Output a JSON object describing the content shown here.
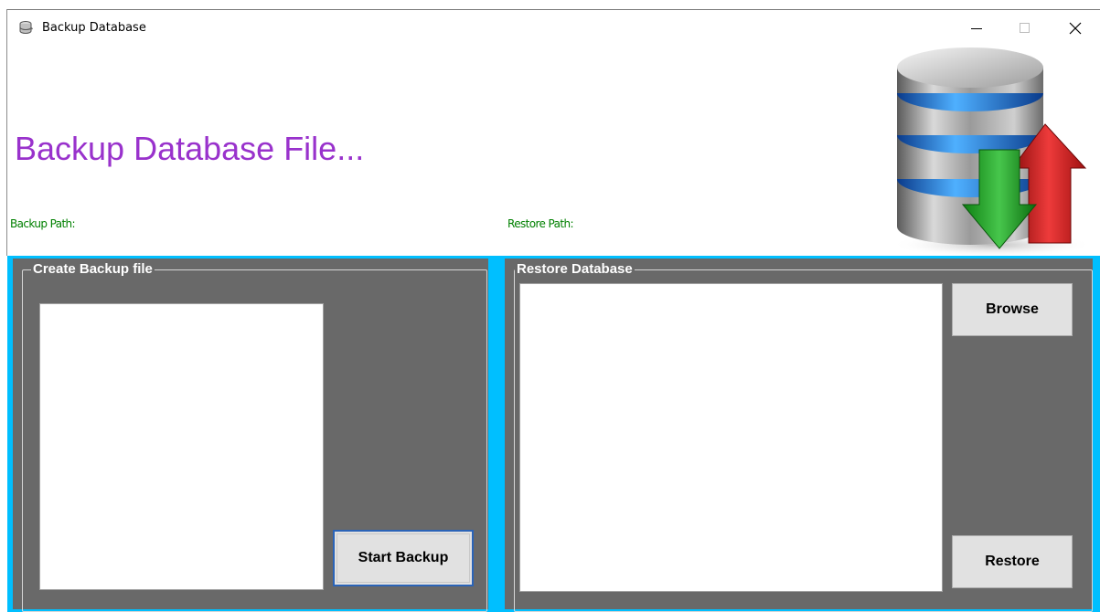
{
  "window": {
    "title": "Backup Database",
    "app_icon": "database-tool-icon",
    "controls": {
      "minimize_icon": "minimize-icon",
      "maximize_icon": "maximize-icon",
      "close_icon": "close-icon"
    }
  },
  "header": {
    "heading": "Backup Database File...",
    "backup_path_label": "Backup Path:",
    "restore_path_label": "Restore Path:",
    "art_icon": "database-backup-restore-icon"
  },
  "backup_group": {
    "title": "Create Backup file",
    "start_button": "Start Backup"
  },
  "restore_group": {
    "title": "Restore Database",
    "browse_button": "Browse",
    "restore_button": "Restore"
  },
  "colors": {
    "heading": "#9932cc",
    "path_labels": "#008000",
    "frame_background": "#00bfff",
    "panel_background": "#696969"
  }
}
